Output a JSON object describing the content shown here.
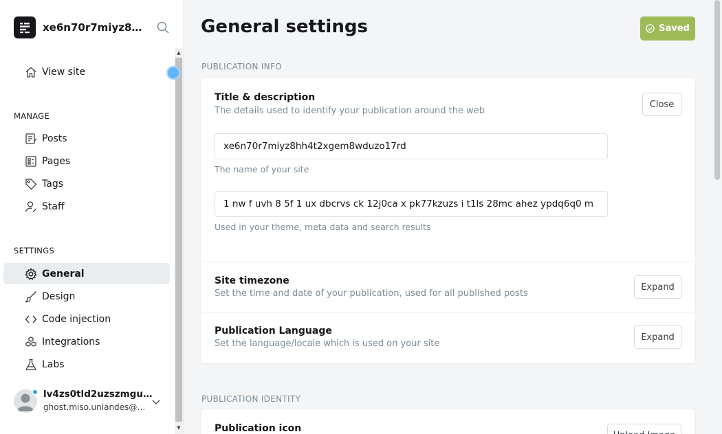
{
  "site": {
    "title": "xe6n70r7miyz8hhh..."
  },
  "nav": {
    "view_site": "View site",
    "manage_heading": "MANAGE",
    "manage": [
      {
        "label": "Posts"
      },
      {
        "label": "Pages"
      },
      {
        "label": "Tags"
      },
      {
        "label": "Staff"
      }
    ],
    "settings_heading": "SETTINGS",
    "settings": [
      {
        "label": "General"
      },
      {
        "label": "Design"
      },
      {
        "label": "Code injection"
      },
      {
        "label": "Integrations"
      },
      {
        "label": "Labs"
      }
    ]
  },
  "user": {
    "name": "lv4zs0tld2uzszmguul...",
    "email": "ghost.miso.uniandes@g..."
  },
  "page": {
    "title": "General settings",
    "saved_label": "Saved"
  },
  "publication_info": {
    "heading": "PUBLICATION INFO",
    "title_desc": {
      "title": "Title & description",
      "desc": "The details used to identify your publication around the web",
      "close_label": "Close",
      "site_title_value": "xe6n70r7miyz8hh4t2xgem8wduzo17rd",
      "site_title_hint": "The name of your site",
      "description_value": "1  nw    f uvh  8 5f 1 ux dbcrvs ck 12j0ca x pk77kzuzs i   t1ls 28mc ahez ypdq6q0  m",
      "description_hint": "Used in your theme, meta data and search results"
    },
    "timezone": {
      "title": "Site timezone",
      "desc": "Set the time and date of your publication, used for all published posts",
      "expand_label": "Expand"
    },
    "language": {
      "title": "Publication Language",
      "desc": "Set the language/locale which is used on your site",
      "expand_label": "Expand"
    }
  },
  "publication_identity": {
    "heading": "PUBLICATION IDENTITY",
    "icon_title": "Publication icon",
    "upload_label": "Upload Image"
  },
  "colors": {
    "saved_green": "#9fbb58",
    "active_nav_bg": "#e9edf0",
    "muted_text": "#7c8b9a"
  }
}
